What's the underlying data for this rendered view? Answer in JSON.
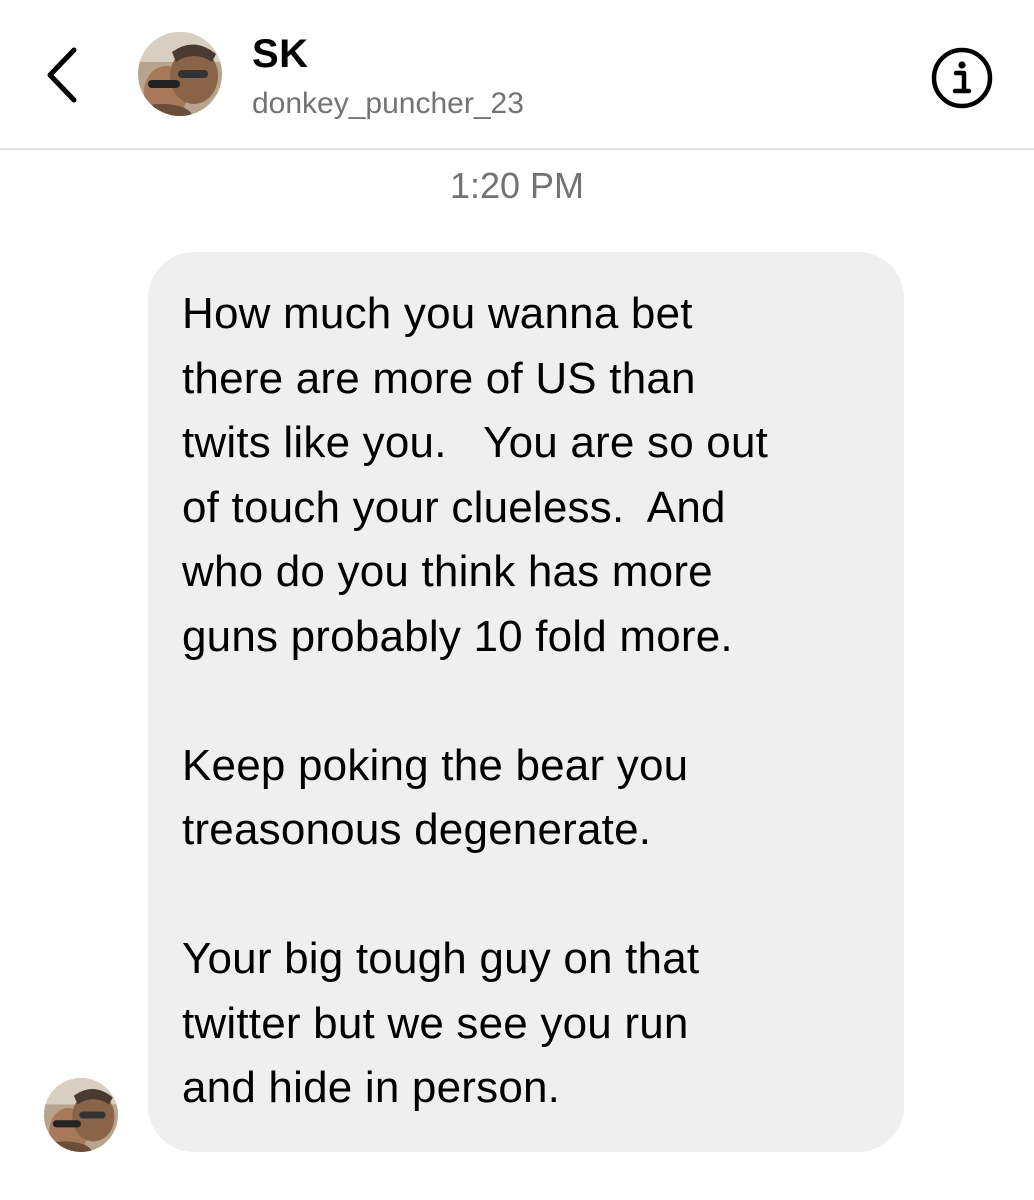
{
  "header": {
    "display_name": "SK",
    "username": "donkey_puncher_23",
    "back_icon": "chevron-left-icon",
    "info_icon": "info-circle-icon"
  },
  "thread": {
    "timestamp": "1:20 PM",
    "message": {
      "lines_1": [
        "How much you wanna bet",
        "there are more of US than",
        "twits like you.   You are so out",
        "of touch your clueless.  And",
        "who do you think has more",
        "guns probably 10 fold more."
      ],
      "lines_2": [
        "Keep poking the bear you",
        "treasonous degenerate."
      ],
      "lines_3": [
        "Your big tough guy on that",
        "twitter but we see you run",
        "and hide in person."
      ]
    }
  },
  "colors": {
    "bubble_bg": "#efefef",
    "secondary_text": "#737373",
    "divider": "#e5e5e5"
  }
}
